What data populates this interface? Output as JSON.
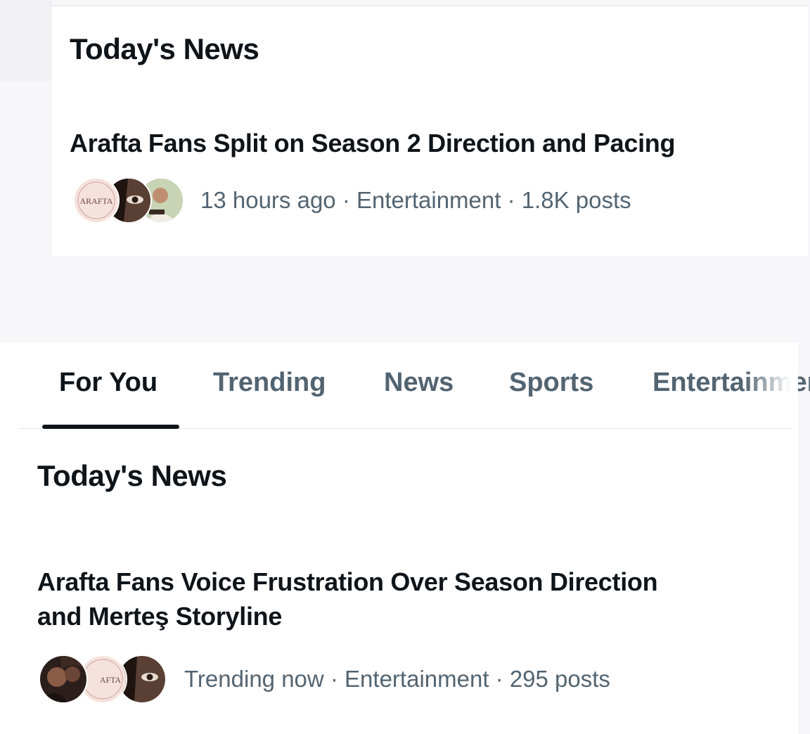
{
  "top_card": {
    "section_title": "Today's News",
    "headline": "Arafta Fans Split on Season 2 Direction and Pacing",
    "meta": "13 hours ago · Entertainment · 1.8K posts",
    "logo_text": "ARAFTA"
  },
  "tabs": [
    {
      "label": "For You",
      "active": true
    },
    {
      "label": "Trending",
      "active": false
    },
    {
      "label": "News",
      "active": false
    },
    {
      "label": "Sports",
      "active": false
    },
    {
      "label": "Entertainment",
      "active": false
    }
  ],
  "bottom_card": {
    "section_title": "Today's News",
    "headline_line1": "Arafta Fans Voice Frustration Over Season Direction",
    "headline_line2": "and Merteş Storyline",
    "meta": "Trending now · Entertainment · 295 posts",
    "logo_text": "AFTA"
  },
  "colors": {
    "text_primary": "#0f1419",
    "text_secondary": "#536471",
    "divider": "#e3e6e8"
  }
}
